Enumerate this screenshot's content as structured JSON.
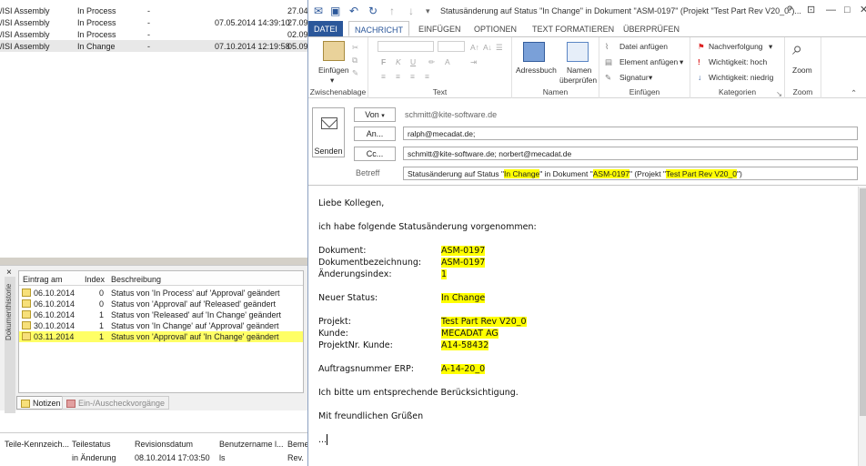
{
  "top_list": {
    "rows": [
      {
        "name": "/ISI Assembly",
        "status": "In Process",
        "dash": "-",
        "date": "",
        "extra": "27.04"
      },
      {
        "name": "/ISI Assembly",
        "status": "In Process",
        "dash": "-",
        "date": "07.05.2014 14:39:10",
        "extra": "27.09"
      },
      {
        "name": "/ISI Assembly",
        "status": "In Process",
        "dash": "-",
        "date": "",
        "extra": "02.09"
      },
      {
        "name": "/ISI Assembly",
        "status": "In Change",
        "dash": "-",
        "date": "07.10.2014 12:19:58",
        "extra": "05.09"
      }
    ]
  },
  "history": {
    "side_label": "Dokumenthistorie",
    "close": "×",
    "columns": {
      "date": "Eintrag am",
      "index": "Index",
      "desc": "Beschreibung"
    },
    "rows": [
      {
        "date": "06.10.2014",
        "index": "0",
        "desc": "Status von 'In Process' auf 'Approval' geändert"
      },
      {
        "date": "06.10.2014",
        "index": "0",
        "desc": "Status von 'Approval' auf 'Released' geändert"
      },
      {
        "date": "06.10.2014",
        "index": "1",
        "desc": "Status von 'Released' auf 'In Change' geändert"
      },
      {
        "date": "30.10.2014",
        "index": "1",
        "desc": "Status von 'In Change' auf 'Approval' geändert"
      },
      {
        "date": "03.11.2014",
        "index": "1",
        "desc": "Status von 'Approval' auf 'In Change' geändert"
      }
    ],
    "tabs": [
      "Notizen",
      "Ein-/Auscheckvorgänge"
    ]
  },
  "bottom_table": {
    "columns": [
      "Teile-Kennzeich...",
      "Teilestatus",
      "Revisionsdatum",
      "Benutzername l...",
      "Beme"
    ],
    "row": [
      "",
      "in Änderung",
      "08.10.2014 17:03:50",
      "ls",
      "Rev."
    ]
  },
  "window": {
    "title": "Statusänderung auf Status \"In Change\" in Dokument \"ASM-0197\" (Projekt \"Test Part Rev V20_0\")...",
    "controls": {
      "help": "?",
      "ribbon": "⊡",
      "minimize": "—",
      "maximize": "□",
      "close": "✕"
    }
  },
  "ribbon": {
    "tabs": [
      "DATEI",
      "NACHRICHT",
      "EINFÜGEN",
      "OPTIONEN",
      "TEXT FORMATIEREN",
      "ÜBERPRÜFEN"
    ],
    "groups": {
      "clipboard": {
        "label": "Zwischenablage",
        "paste": "Einfügen"
      },
      "text": {
        "label": "Text",
        "bold": "F",
        "italic": "K",
        "underline": "U"
      },
      "names": {
        "label": "Namen",
        "addressbook": "Adressbuch",
        "check_names_1": "Namen",
        "check_names_2": "überprüfen"
      },
      "insert": {
        "label": "Einfügen",
        "attach_file": "Datei anfügen",
        "attach_item": "Element anfügen",
        "signature": "Signatur"
      },
      "tags": {
        "label": "Kategorien",
        "followup": "Nachverfolgung",
        "high": "Wichtigkeit: hoch",
        "low": "Wichtigkeit: niedrig"
      },
      "zoom": {
        "label": "Zoom",
        "zoom": "Zoom"
      }
    }
  },
  "header": {
    "send": "Senden",
    "from_btn": "Von",
    "from_value": "schmitt@kite-software.de",
    "to_btn": "An...",
    "to_value": "ralph@mecadat.de;",
    "cc_btn": "Cc...",
    "cc_value": "schmitt@kite-software.de; norbert@mecadat.de",
    "subject_label": "Betreff",
    "subject": {
      "p1": "Statusänderung auf Status \"",
      "hl1": "In Change",
      "p2": "\" in Dokument \"",
      "hl2": "ASM-0197",
      "p3": "\" (Projekt \"",
      "hl3": "Test Part Rev V20_0",
      "p4": "\")"
    }
  },
  "body": {
    "greeting": "Liebe Kollegen,",
    "intro": "ich habe folgende Statusänderung vorgenommen:",
    "fields": [
      {
        "label": "Dokument:",
        "value": "ASM-0197"
      },
      {
        "label": "Dokumentbezeichnung:",
        "value": "ASM-0197"
      },
      {
        "label": "Änderungsindex:",
        "value": "1"
      },
      {
        "label": "Neuer Status:",
        "value": "In Change"
      },
      {
        "label": "Projekt:",
        "value": "Test Part Rev V20_0"
      },
      {
        "label": "Kunde:",
        "value": "MECADAT AG"
      },
      {
        "label": "ProjektNr. Kunde:",
        "value": "A14-58432"
      },
      {
        "label": "Auftragsnummer ERP:",
        "value": "A-14-20_0"
      }
    ],
    "request": "Ich bitte um entsprechende Berücksichtigung.",
    "closing": "Mit freundlichen Grüßen",
    "signature": "..."
  }
}
